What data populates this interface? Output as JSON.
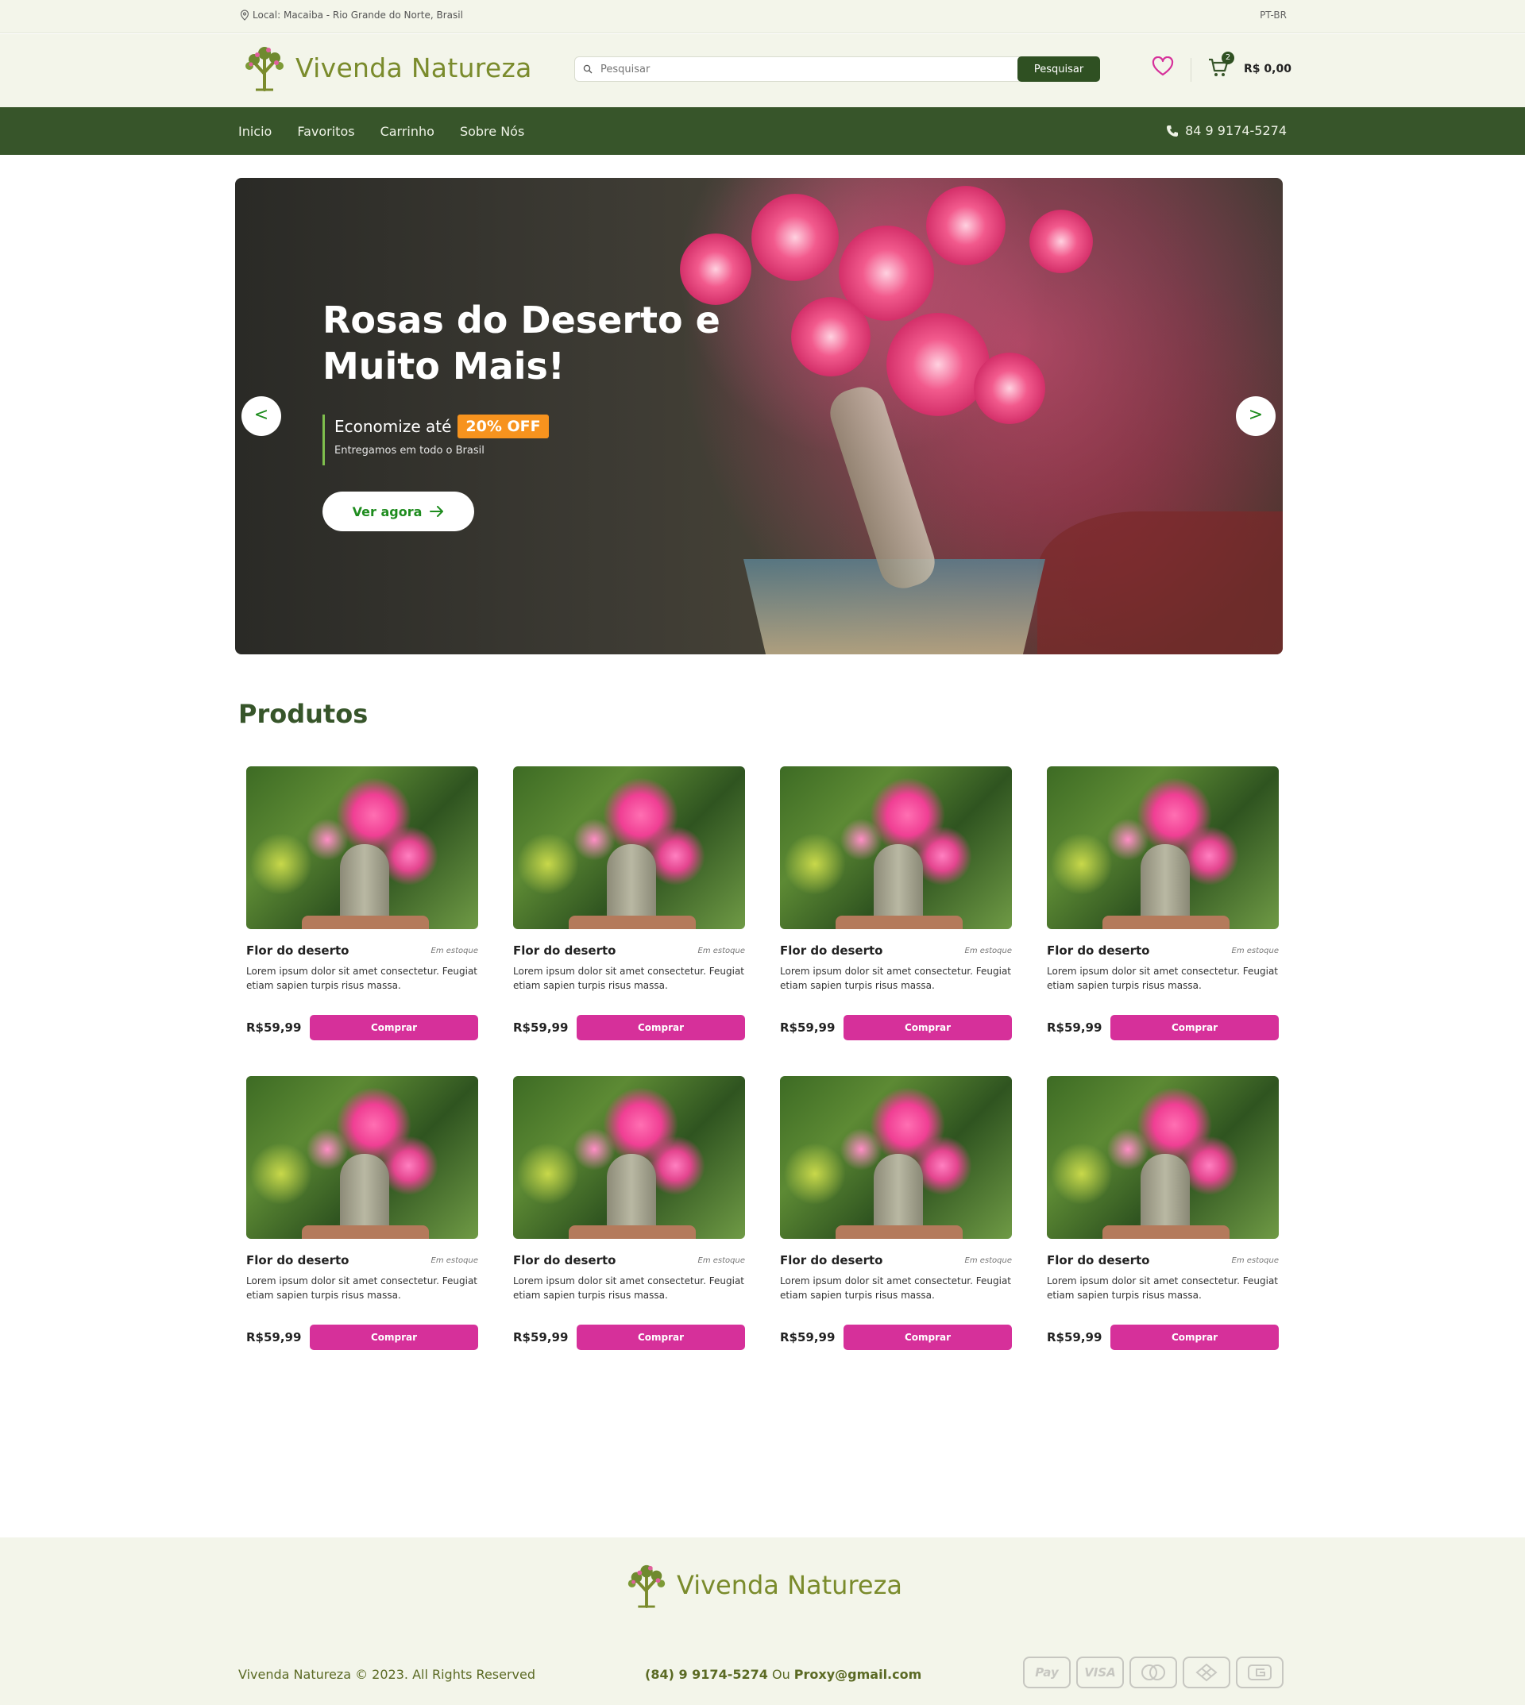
{
  "topbar": {
    "location": "Local: Macaiba - Rio Grande do Norte, Brasil",
    "language": "PT-BR"
  },
  "header": {
    "brand": "Vivenda Natureza",
    "search": {
      "placeholder": "Pesquisar",
      "button": "Pesquisar"
    },
    "cart": {
      "count": "2",
      "total": "R$ 0,00"
    }
  },
  "nav": {
    "items": [
      {
        "label": "Inicio"
      },
      {
        "label": "Favoritos"
      },
      {
        "label": "Carrinho"
      },
      {
        "label": "Sobre Nós"
      }
    ],
    "phone": "84 9 9174-5274"
  },
  "hero": {
    "title": "Rosas do Deserto e Muito Mais!",
    "promo_prefix": "Economize até",
    "promo_badge": "20% OFF",
    "subtitle": "Entregamos em todo o Brasil",
    "cta": "Ver agora",
    "prev": "<",
    "next": ">"
  },
  "products": {
    "title": "Produtos",
    "items": [
      {
        "name": "Flor do deserto",
        "stock": "Em estoque",
        "desc": "Lorem ipsum dolor sit amet consectetur. Feugiat etiam sapien turpis risus massa.",
        "price": "R$59,99",
        "button": "Comprar"
      },
      {
        "name": "Flor do deserto",
        "stock": "Em estoque",
        "desc": "Lorem ipsum dolor sit amet consectetur. Feugiat etiam sapien turpis risus massa.",
        "price": "R$59,99",
        "button": "Comprar"
      },
      {
        "name": "Flor do deserto",
        "stock": "Em estoque",
        "desc": "Lorem ipsum dolor sit amet consectetur. Feugiat etiam sapien turpis risus massa.",
        "price": "R$59,99",
        "button": "Comprar"
      },
      {
        "name": "Flor do deserto",
        "stock": "Em estoque",
        "desc": "Lorem ipsum dolor sit amet consectetur. Feugiat etiam sapien turpis risus massa.",
        "price": "R$59,99",
        "button": "Comprar"
      },
      {
        "name": "Flor do deserto",
        "stock": "Em estoque",
        "desc": "Lorem ipsum dolor sit amet consectetur. Feugiat etiam sapien turpis risus massa.",
        "price": "R$59,99",
        "button": "Comprar"
      },
      {
        "name": "Flor do deserto",
        "stock": "Em estoque",
        "desc": "Lorem ipsum dolor sit amet consectetur. Feugiat etiam sapien turpis risus massa.",
        "price": "R$59,99",
        "button": "Comprar"
      },
      {
        "name": "Flor do deserto",
        "stock": "Em estoque",
        "desc": "Lorem ipsum dolor sit amet consectetur. Feugiat etiam sapien turpis risus massa.",
        "price": "R$59,99",
        "button": "Comprar"
      },
      {
        "name": "Flor do deserto",
        "stock": "Em estoque",
        "desc": "Lorem ipsum dolor sit amet consectetur. Feugiat etiam sapien turpis risus massa.",
        "price": "R$59,99",
        "button": "Comprar"
      }
    ]
  },
  "footer": {
    "brand": "Vivenda Natureza",
    "copyright": "Vivenda Natureza © 2023. All Rights Reserved",
    "phone": "(84) 9 9174-5274",
    "or": "Ou",
    "email": "Proxy@gmail.com",
    "payments": [
      {
        "label": "Pay",
        "icon": "apple-pay-icon"
      },
      {
        "label": "VISA",
        "icon": "visa-icon"
      },
      {
        "label": "",
        "icon": "mastercard-icon"
      },
      {
        "label": "",
        "icon": "diners-icon"
      },
      {
        "label": "",
        "icon": "generic-card-icon"
      }
    ]
  },
  "colors": {
    "nav_green": "#37552a",
    "brand_olive": "#7a8b2c",
    "buy_pink": "#d6309a",
    "promo_orange": "#f7931e",
    "cta_green": "#1e8c1e"
  }
}
